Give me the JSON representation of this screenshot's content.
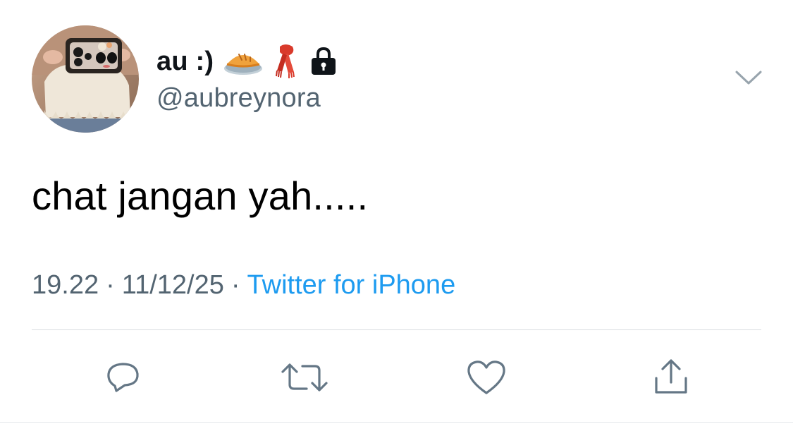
{
  "profile": {
    "display_name": "au :)",
    "handle": "@aubreynora",
    "name_icons": [
      "pie-emoji",
      "scarf-emoji",
      "lock-icon"
    ]
  },
  "tweet": {
    "text": "chat jangan yah.....",
    "time": "19.22",
    "date": "11/12/25",
    "separator": "·",
    "source": "Twitter for iPhone"
  },
  "actions": [
    "reply-icon",
    "retweet-icon",
    "like-icon",
    "share-icon"
  ],
  "colors": {
    "text": "#0f1419",
    "secondary": "#536471",
    "link": "#1d9bf0",
    "divider": "#d9dde1"
  }
}
